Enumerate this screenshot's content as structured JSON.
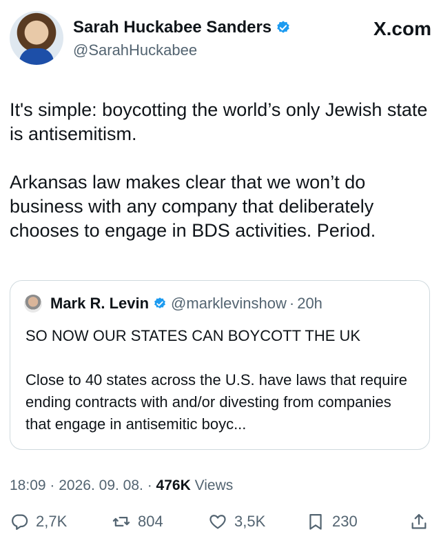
{
  "author": {
    "name": "Sarah Huckabee Sanders",
    "handle": "@SarahHuckabee",
    "verified": true
  },
  "brand": "X.com",
  "tweet": {
    "paragraphs": [
      "It's simple: boycotting the world’s only Jewish state is antisemitism.",
      "Arkansas law makes clear that we won’t do business with any company that deliberately chooses to engage in BDS activities. Period."
    ]
  },
  "quote": {
    "name": "Mark R. Levin",
    "handle": "@marklevinshow",
    "separator": "·",
    "time": "20h",
    "paragraphs": [
      "SO NOW OUR STATES CAN BOYCOTT THE UK",
      "Close to 40 states across the U.S. have laws that require ending contracts with and/or divesting from companies that engage in antisemitic boyc..."
    ]
  },
  "meta": {
    "time": "18:09",
    "separator": "·",
    "date": "2026. 09. 08.",
    "views_count": "476K",
    "views_label": "Views"
  },
  "actions": {
    "replies": "2,7K",
    "reposts": "804",
    "likes": "3,5K",
    "bookmarks": "230"
  },
  "colors": {
    "text": "#0f1419",
    "secondary": "#536471",
    "verified": "#1d9bf0",
    "border": "#cfd9de"
  }
}
